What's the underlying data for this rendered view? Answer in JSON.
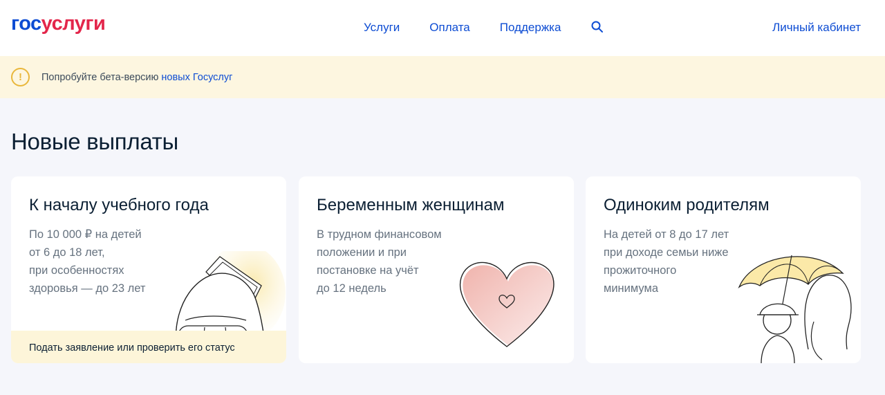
{
  "header": {
    "logo_part1": "гос",
    "logo_part2": "услуги",
    "nav": [
      "Услуги",
      "Оплата",
      "Поддержка"
    ],
    "search_icon": "search-icon",
    "cabinet": "Личный кабинет"
  },
  "beta_banner": {
    "icon": "warning-icon",
    "text": "Попробуйте бета-версию ",
    "link": "новых Госуслуг"
  },
  "section": {
    "title": "Новые выплаты"
  },
  "cards": [
    {
      "title": "К началу учебного года",
      "desc": [
        "По 10 000 ₽ на детей",
        "от 6 до 18 лет,",
        "при особенностях",
        "здоровья — до 23 лет"
      ],
      "footer": "Подать заявление или проверить его статус",
      "illustration": "backpack-icon"
    },
    {
      "title": "Беременным женщинам",
      "desc": [
        "В трудном финансовом",
        "положении и при",
        "постановке на учёт",
        "до 12 недель"
      ],
      "illustration": "heart-icon"
    },
    {
      "title": "Одиноким родителям",
      "desc": [
        "На детей от 8 до 17 лет",
        "при доходе семьи ниже",
        "прожиточного",
        "минимума"
      ],
      "illustration": "umbrella-family-icon"
    }
  ],
  "colors": {
    "brand_blue": "#0d4cd3",
    "brand_red": "#e3264b",
    "beta_bg": "#fdf6e0",
    "page_bg": "#f5f6fb"
  }
}
